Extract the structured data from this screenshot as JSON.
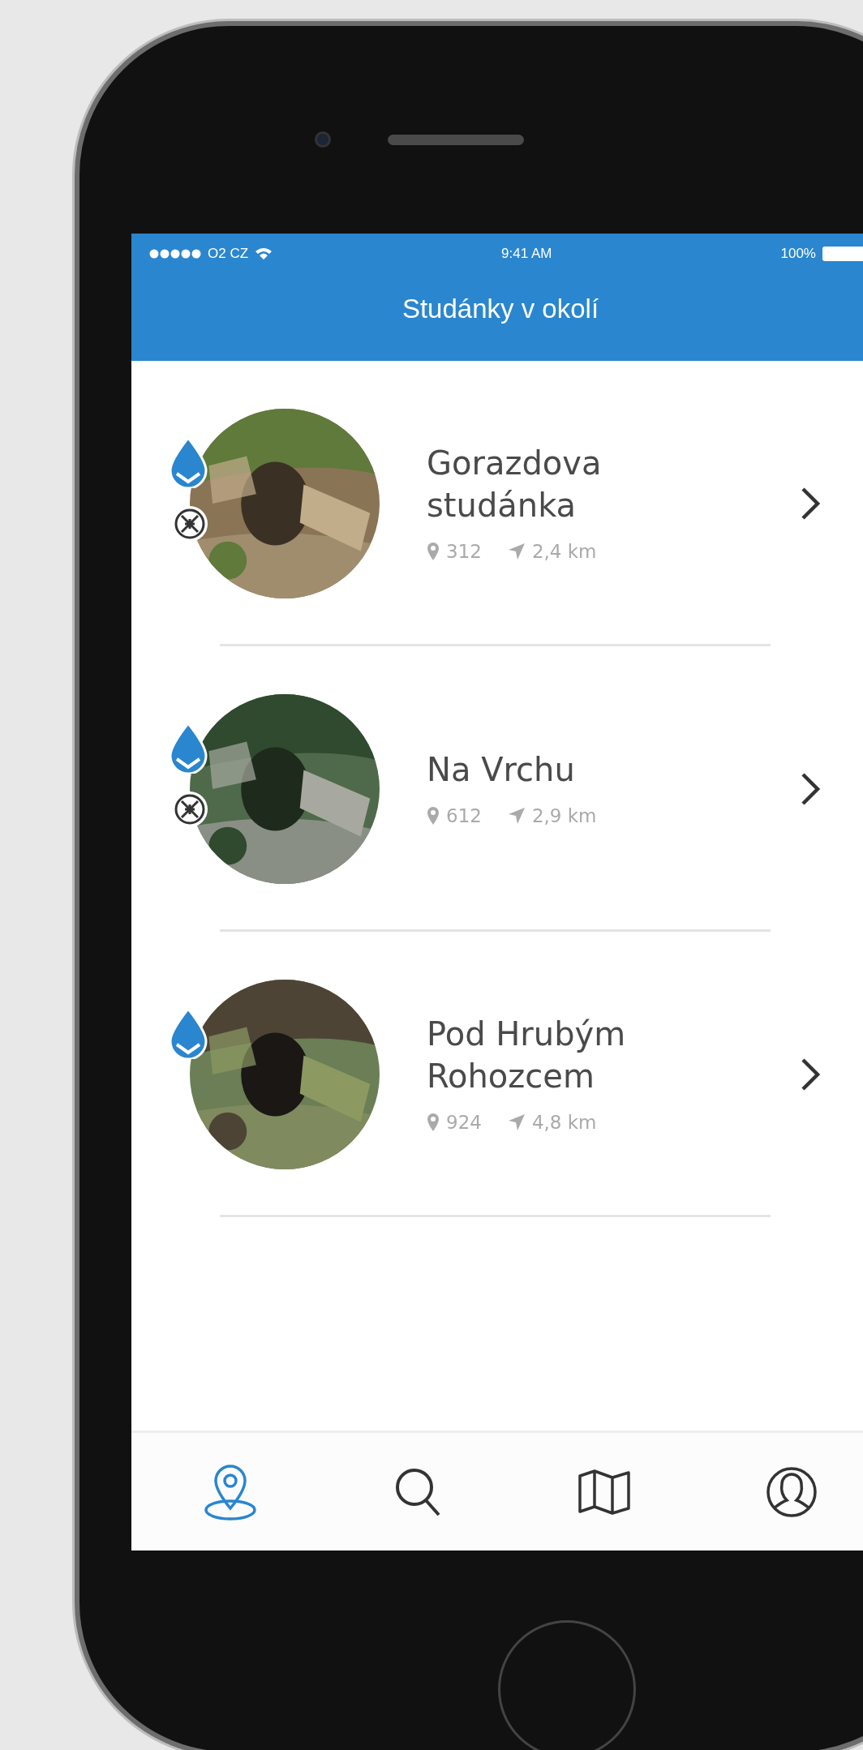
{
  "status_bar": {
    "carrier": "O2 CZ",
    "time": "9:41 AM",
    "battery": "100%"
  },
  "nav_bar": {
    "title": "Studánky v okolí"
  },
  "springs": [
    {
      "name": "Gorazdova studánka",
      "elevation": "312",
      "distance": "2,4 km",
      "water": true,
      "geocache": true
    },
    {
      "name": "Na Vrchu",
      "elevation": "612",
      "distance": "2,9 km",
      "water": true,
      "geocache": true
    },
    {
      "name": "Pod Hrubým Rohozcem",
      "elevation": "924",
      "distance": "4,8 km",
      "water": true,
      "geocache": false
    }
  ],
  "tab_bar": [
    {
      "kind": "nearby",
      "selected": true
    },
    {
      "kind": "search",
      "selected": false
    },
    {
      "kind": "map",
      "selected": false
    },
    {
      "kind": "profile",
      "selected": false
    }
  ]
}
